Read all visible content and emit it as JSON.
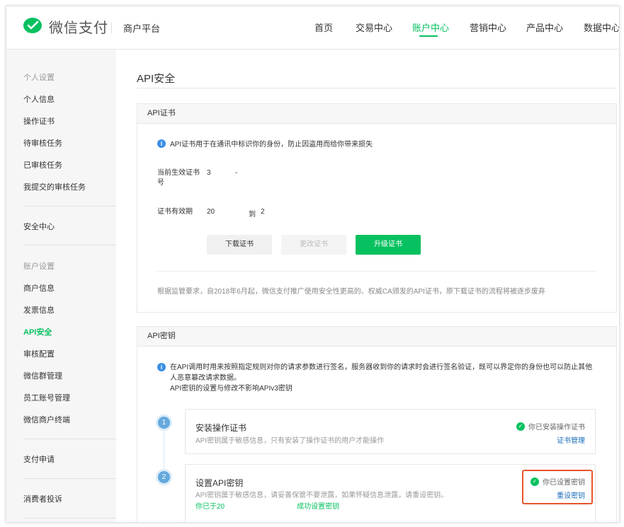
{
  "header": {
    "logo_text": "微信支付",
    "platform": "商户平台",
    "nav": [
      "首页",
      "交易中心",
      "账户中心",
      "营销中心",
      "产品中心",
      "数据中心"
    ],
    "active_nav": "账户中心"
  },
  "sidebar": {
    "group_personal": "个人设置",
    "personal_items": [
      "个人信息",
      "操作证书",
      "待审核任务",
      "已审核任务",
      "我提交的审核任务"
    ],
    "security_center": "安全中心",
    "group_account": "账户设置",
    "account_items": [
      "商户信息",
      "发票信息",
      "API安全",
      "审核配置",
      "微信群管理",
      "员工账号管理",
      "微信商户终端"
    ],
    "pay_apply": "支付申请",
    "consumer_complaint": "消费者投诉",
    "active_item": "API安全"
  },
  "page": {
    "title": "API安全"
  },
  "cert_card": {
    "title": "API证书",
    "notice": "API证书用于在通讯中标识你的身份，防止因盗用而给你带来损失",
    "label_serial": "当前生效证书号",
    "value_serial": "3",
    "value_serial_tail": "-",
    "label_validity": "证书有效期",
    "validity_start": "20",
    "validity_to": "到",
    "validity_end": "2",
    "btn_download": "下载证书",
    "btn_change": "更改证书",
    "btn_upgrade": "升级证书",
    "footer": "根据监管要求，自2018年6月起，微信支付推广使用安全性更高的、权威CA颁发的API证书，原下载证书的流程将被逐步废弃"
  },
  "key_card": {
    "title": "API密钥",
    "notice_line1": "在API调用时用来按照指定规则对你的请求参数进行签名，服务器收到你的请求时会进行签名验证，既可以界定你的身份也可以防止其他人恶意篡改请求数据。",
    "notice_line2": "API密钥的设置与修改不影响APIv3密钥",
    "step1": {
      "num": "1",
      "title": "安装操作证书",
      "desc": "API密钥属于敏感信息，只有安装了操作证书的用户才能操作",
      "status": "你已安装操作证书",
      "link": "证书管理"
    },
    "step2": {
      "num": "2",
      "title": "设置API密钥",
      "desc": "API密钥属于敏感信息，请妥善保管不要泄露，如果怀疑信息泄露，请重设密钥。",
      "desc2_start": "你已于20",
      "desc2_end": "成功设置密钥",
      "status": "你已设置密钥",
      "link": "重设密钥"
    }
  }
}
